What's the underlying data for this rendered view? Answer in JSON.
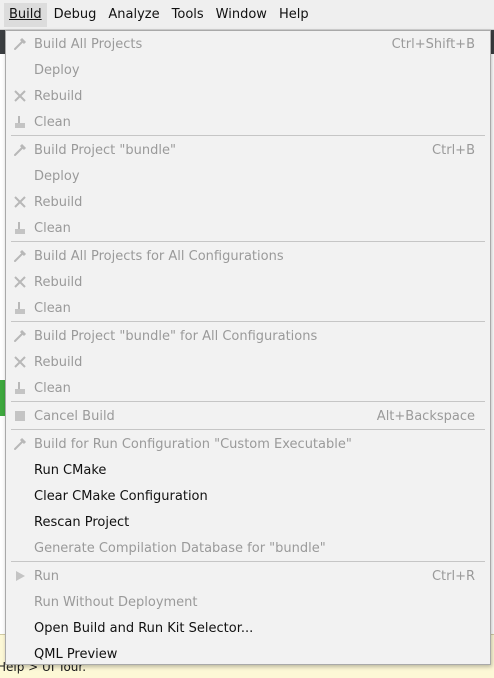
{
  "menubar": {
    "items": [
      {
        "label": "Build"
      },
      {
        "label": "Debug"
      },
      {
        "label": "Analyze"
      },
      {
        "label": "Tools"
      },
      {
        "label": "Window"
      },
      {
        "label": "Help"
      }
    ]
  },
  "menu": {
    "items": [
      {
        "label": "Build All Projects",
        "shortcut": "Ctrl+Shift+B",
        "enabled": false,
        "icon": "hammer-icon"
      },
      {
        "label": "Deploy",
        "enabled": false
      },
      {
        "label": "Rebuild",
        "enabled": false,
        "icon": "rebuild-icon"
      },
      {
        "label": "Clean",
        "enabled": false,
        "icon": "clean-icon"
      },
      {
        "label": "Build Project \"bundle\"",
        "shortcut": "Ctrl+B",
        "enabled": false,
        "icon": "hammer-icon"
      },
      {
        "label": "Deploy",
        "enabled": false
      },
      {
        "label": "Rebuild",
        "enabled": false,
        "icon": "rebuild-icon"
      },
      {
        "label": "Clean",
        "enabled": false,
        "icon": "clean-icon"
      },
      {
        "label": "Build All Projects for All Configurations",
        "enabled": false,
        "icon": "hammer-icon"
      },
      {
        "label": "Rebuild",
        "enabled": false,
        "icon": "rebuild-icon"
      },
      {
        "label": "Clean",
        "enabled": false,
        "icon": "clean-icon"
      },
      {
        "label": "Build Project \"bundle\" for All Configurations",
        "enabled": false,
        "icon": "hammer-icon"
      },
      {
        "label": "Rebuild",
        "enabled": false,
        "icon": "rebuild-icon"
      },
      {
        "label": "Clean",
        "enabled": false,
        "icon": "clean-icon"
      },
      {
        "label": "Cancel Build",
        "shortcut": "Alt+Backspace",
        "enabled": false,
        "icon": "stop-icon"
      },
      {
        "label": "Build for Run Configuration \"Custom Executable\"",
        "enabled": false,
        "icon": "hammer-icon"
      },
      {
        "label": "Run CMake",
        "enabled": true
      },
      {
        "label": "Clear CMake Configuration",
        "enabled": true
      },
      {
        "label": "Rescan Project",
        "enabled": true
      },
      {
        "label": "Generate Compilation Database for \"bundle\"",
        "enabled": false
      },
      {
        "label": "Run",
        "shortcut": "Ctrl+R",
        "enabled": false,
        "icon": "play-icon"
      },
      {
        "label": "Run Without Deployment",
        "enabled": false
      },
      {
        "label": "Open Build and Run Kit Selector...",
        "enabled": true
      },
      {
        "label": "QML Preview",
        "enabled": true
      }
    ]
  },
  "status": {
    "text": "Help > UI Tour."
  }
}
